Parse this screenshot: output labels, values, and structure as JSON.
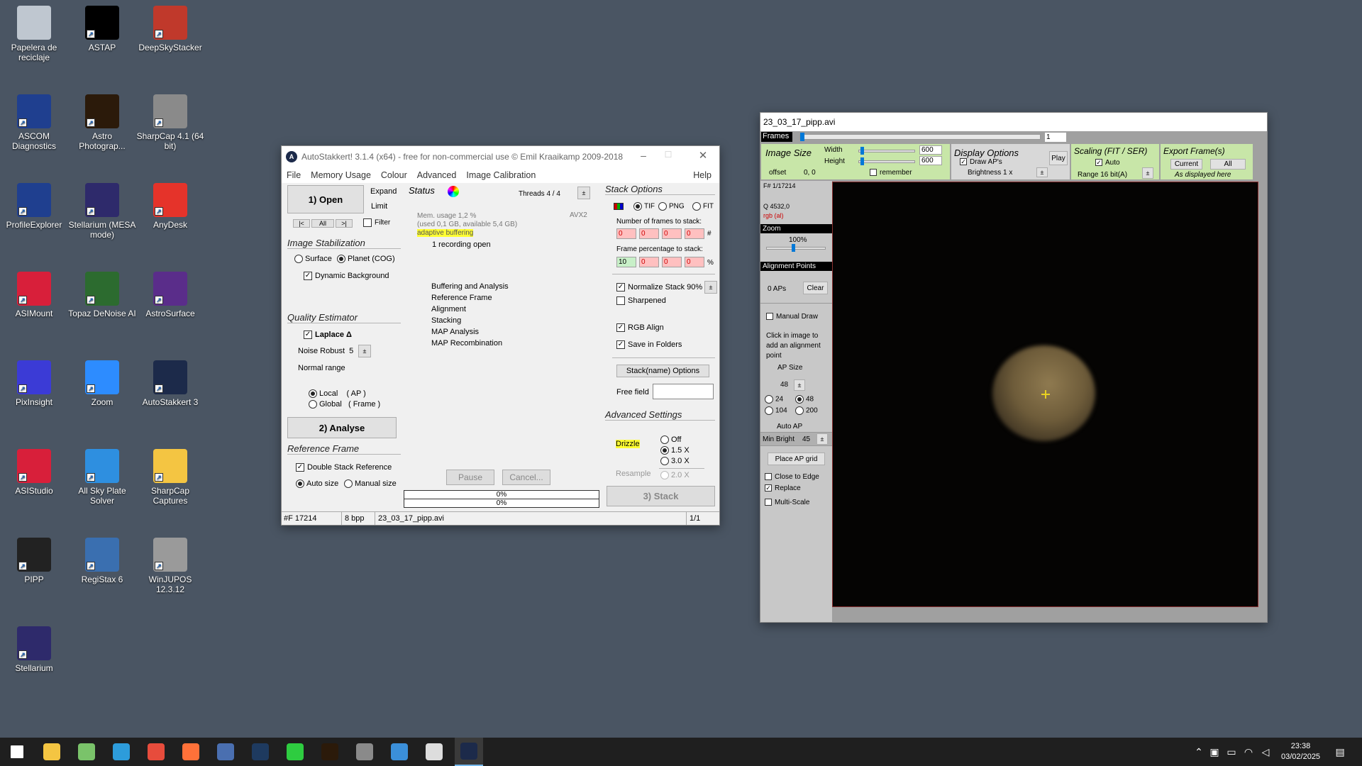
{
  "desktop": {
    "icons": [
      {
        "label": "Papelera de reciclaje",
        "icon": "recycle-bin-icon",
        "color": "#bfc7d0"
      },
      {
        "label": "ASTAP",
        "icon": "astap-icon",
        "color": "#000000"
      },
      {
        "label": "DeepSkyStacker",
        "icon": "deepskystacker-icon",
        "color": "#c0392b"
      },
      {
        "label": "ASCOM Diagnostics",
        "icon": "ascom-icon",
        "color": "#1f3f8f"
      },
      {
        "label": "Astro Photograp...",
        "icon": "astro-photography-icon",
        "color": "#2b1a0a"
      },
      {
        "label": "SharpCap 4.1 (64 bit)",
        "icon": "sharpcap-icon",
        "color": "#8a8a8a"
      },
      {
        "label": "ProfileExplorer",
        "icon": "profile-explorer-icon",
        "color": "#1f3f8f"
      },
      {
        "label": "Stellarium (MESA mode)",
        "icon": "stellarium-icon",
        "color": "#2e2a6b"
      },
      {
        "label": "AnyDesk",
        "icon": "anydesk-icon",
        "color": "#e5332a"
      },
      {
        "label": "ASIMount",
        "icon": "asimount-icon",
        "color": "#d81f3a"
      },
      {
        "label": "Topaz DeNoise AI",
        "icon": "topaz-icon",
        "color": "#2c6b2f"
      },
      {
        "label": "AstroSurface",
        "icon": "astrosurface-icon",
        "color": "#5a2d8a"
      },
      {
        "label": "PixInsight",
        "icon": "pixinsight-icon",
        "color": "#3b3bd6"
      },
      {
        "label": "Zoom",
        "icon": "zoom-icon",
        "color": "#2d8cff"
      },
      {
        "label": "AutoStakkert 3",
        "icon": "autostakkert-icon",
        "color": "#1c2a4a"
      },
      {
        "label": "ASIStudio",
        "icon": "asistudio-icon",
        "color": "#d81f3a"
      },
      {
        "label": "All Sky Plate Solver",
        "icon": "all-sky-plate-solver-icon",
        "color": "#2e8fe0"
      },
      {
        "label": "SharpCap Captures",
        "icon": "folder-icon",
        "color": "#f4c542"
      },
      {
        "label": "PIPP",
        "icon": "pipp-icon",
        "color": "#222222"
      },
      {
        "label": "RegiStax 6",
        "icon": "registax-icon",
        "color": "#3a6fb0"
      },
      {
        "label": "WinJUPOS 12.3.12",
        "icon": "winjupos-icon",
        "color": "#9a9a9a"
      },
      {
        "label": "Stellarium",
        "icon": "stellarium-icon",
        "color": "#2e2a6b"
      }
    ]
  },
  "as": {
    "title": "AutoStakkert! 3.1.4 (x64) - free for non-commercial use © Emil Kraaikamp 2009-2018",
    "menu": [
      "File",
      "Memory Usage",
      "Colour",
      "Advanced",
      "Image Calibration"
    ],
    "help": "Help",
    "open_btn": "1) Open",
    "expand": "Expand",
    "limit": "Limit",
    "nav": [
      "|<",
      "All",
      ">|"
    ],
    "filter": "Filter",
    "image_stab": "Image Stabilization",
    "surface": "Surface",
    "planet": "Planet (COG)",
    "dyn_bg": "Dynamic Background",
    "quality": "Quality Estimator",
    "laplace": "Laplace Δ",
    "noise_robust": "Noise Robust",
    "noise_val": "5",
    "normal_range": "Normal range",
    "local": "Local",
    "local_ap": "( AP )",
    "global": "Global",
    "global_frame": "( Frame )",
    "analyse_btn": "2) Analyse",
    "ref_frame": "Reference Frame",
    "double_stack": "Double Stack Reference",
    "auto_size": "Auto size",
    "manual_size": "Manual size",
    "status": "Status",
    "threads": "Threads 4 / 4",
    "avx": "AVX2",
    "mem1": "Mem. usage 1,2 %",
    "mem2": "(used 0,1 GB, available 5,4 GB)",
    "adaptive": "adaptive buffering",
    "recording": "1 recording open",
    "steps": [
      "Buffering and Analysis",
      "Reference Frame",
      "Alignment",
      "Stacking",
      "MAP Analysis",
      "MAP Recombination"
    ],
    "pause": "Pause",
    "cancel": "Cancel...",
    "prog1": "0%",
    "prog2": "0%",
    "stack_opts": "Stack Options",
    "tif": "TIF",
    "png": "PNG",
    "fit": "FIT",
    "num_frames": "Number of frames to stack:",
    "num_vals": [
      "0",
      "0",
      "0",
      "0"
    ],
    "hash": "#",
    "frame_pct": "Frame percentage to stack:",
    "pct_vals": [
      "10",
      "0",
      "0",
      "0"
    ],
    "pct": "%",
    "normalize": "Normalize Stack 90%",
    "sharpened": "Sharpened",
    "rgb_align": "RGB Align",
    "save_folders": "Save in Folders",
    "stackname_btn": "Stack(name) Options",
    "free_field": "Free field",
    "adv_settings": "Advanced Settings",
    "drizzle": "Drizzle",
    "off": "Off",
    "x15": "1.5 X",
    "x30": "3.0 X",
    "resample": "Resample",
    "x20": "2.0 X",
    "stack_btn": "3) Stack",
    "status_frames": "#F 17214",
    "status_bpp": "8 bpp",
    "status_file": "23_03_17_pipp.avi",
    "status_page": "1/1"
  },
  "pv": {
    "title": "23_03_17_pipp.avi",
    "frames": "Frames",
    "frame_val": "1",
    "image_size": "Image Size",
    "width": "Width",
    "width_val": "600",
    "height": "Height",
    "height_val": "600",
    "offset": "offset",
    "offset_val": "0, 0",
    "remember": "remember",
    "display_opts": "Display Options",
    "draw_aps": "Draw AP's",
    "brightness": "Brightness 1 x",
    "play": "Play",
    "scaling": "Scaling (FIT / SER)",
    "auto": "Auto",
    "range": "Range 16 bit(A)",
    "export": "Export Frame(s)",
    "current": "Current",
    "all": "All",
    "as_displayed": "As displayed here",
    "frame_no": "F# 1/17214",
    "q": "Q  4532,0",
    "rgb": "rgb (al)",
    "zoom": "Zoom",
    "zoom_val": "100%",
    "ap_header": "Alignment Points",
    "aps": "0 APs",
    "clear": "Clear",
    "manual_draw": "Manual Draw",
    "click_info": "Click in image to add an alignment point",
    "ap_size": "AP Size",
    "ap_size_val": "48",
    "s24": "24",
    "s48": "48",
    "s104": "104",
    "s200": "200",
    "auto_ap": "Auto AP",
    "min_bright": "Min Bright",
    "min_bright_val": "45",
    "place_grid": "Place AP grid",
    "close_edge": "Close to Edge",
    "replace": "Replace",
    "multi_scale": "Multi-Scale"
  },
  "taskbar": {
    "time": "23:38",
    "date": "03/02/2025",
    "apps": [
      {
        "icon": "windows-start-icon",
        "color": "#ffffff"
      },
      {
        "icon": "file-explorer-icon",
        "color": "#f4c542"
      },
      {
        "icon": "notepad-icon",
        "color": "#7ac36a"
      },
      {
        "icon": "vscode-icon",
        "color": "#2d9cdb"
      },
      {
        "icon": "chrome-icon",
        "color": "#e74c3c"
      },
      {
        "icon": "firefox-icon",
        "color": "#ff7139"
      },
      {
        "icon": "ascom-taskbar-icon",
        "color": "#4a6fb0"
      },
      {
        "icon": "lightroom-icon",
        "color": "#1e3a5f"
      },
      {
        "icon": "phd2-icon",
        "color": "#2ecc40"
      },
      {
        "icon": "astro-photography-taskbar-icon",
        "color": "#2b1a0a"
      },
      {
        "icon": "sharpcap-taskbar-icon",
        "color": "#8a8a8a"
      },
      {
        "icon": "paint-icon",
        "color": "#3b8fd9"
      },
      {
        "icon": "pipp-taskbar-icon",
        "color": "#dddddd"
      },
      {
        "icon": "autostakkert-taskbar-icon",
        "color": "#1c2a4a"
      }
    ]
  }
}
